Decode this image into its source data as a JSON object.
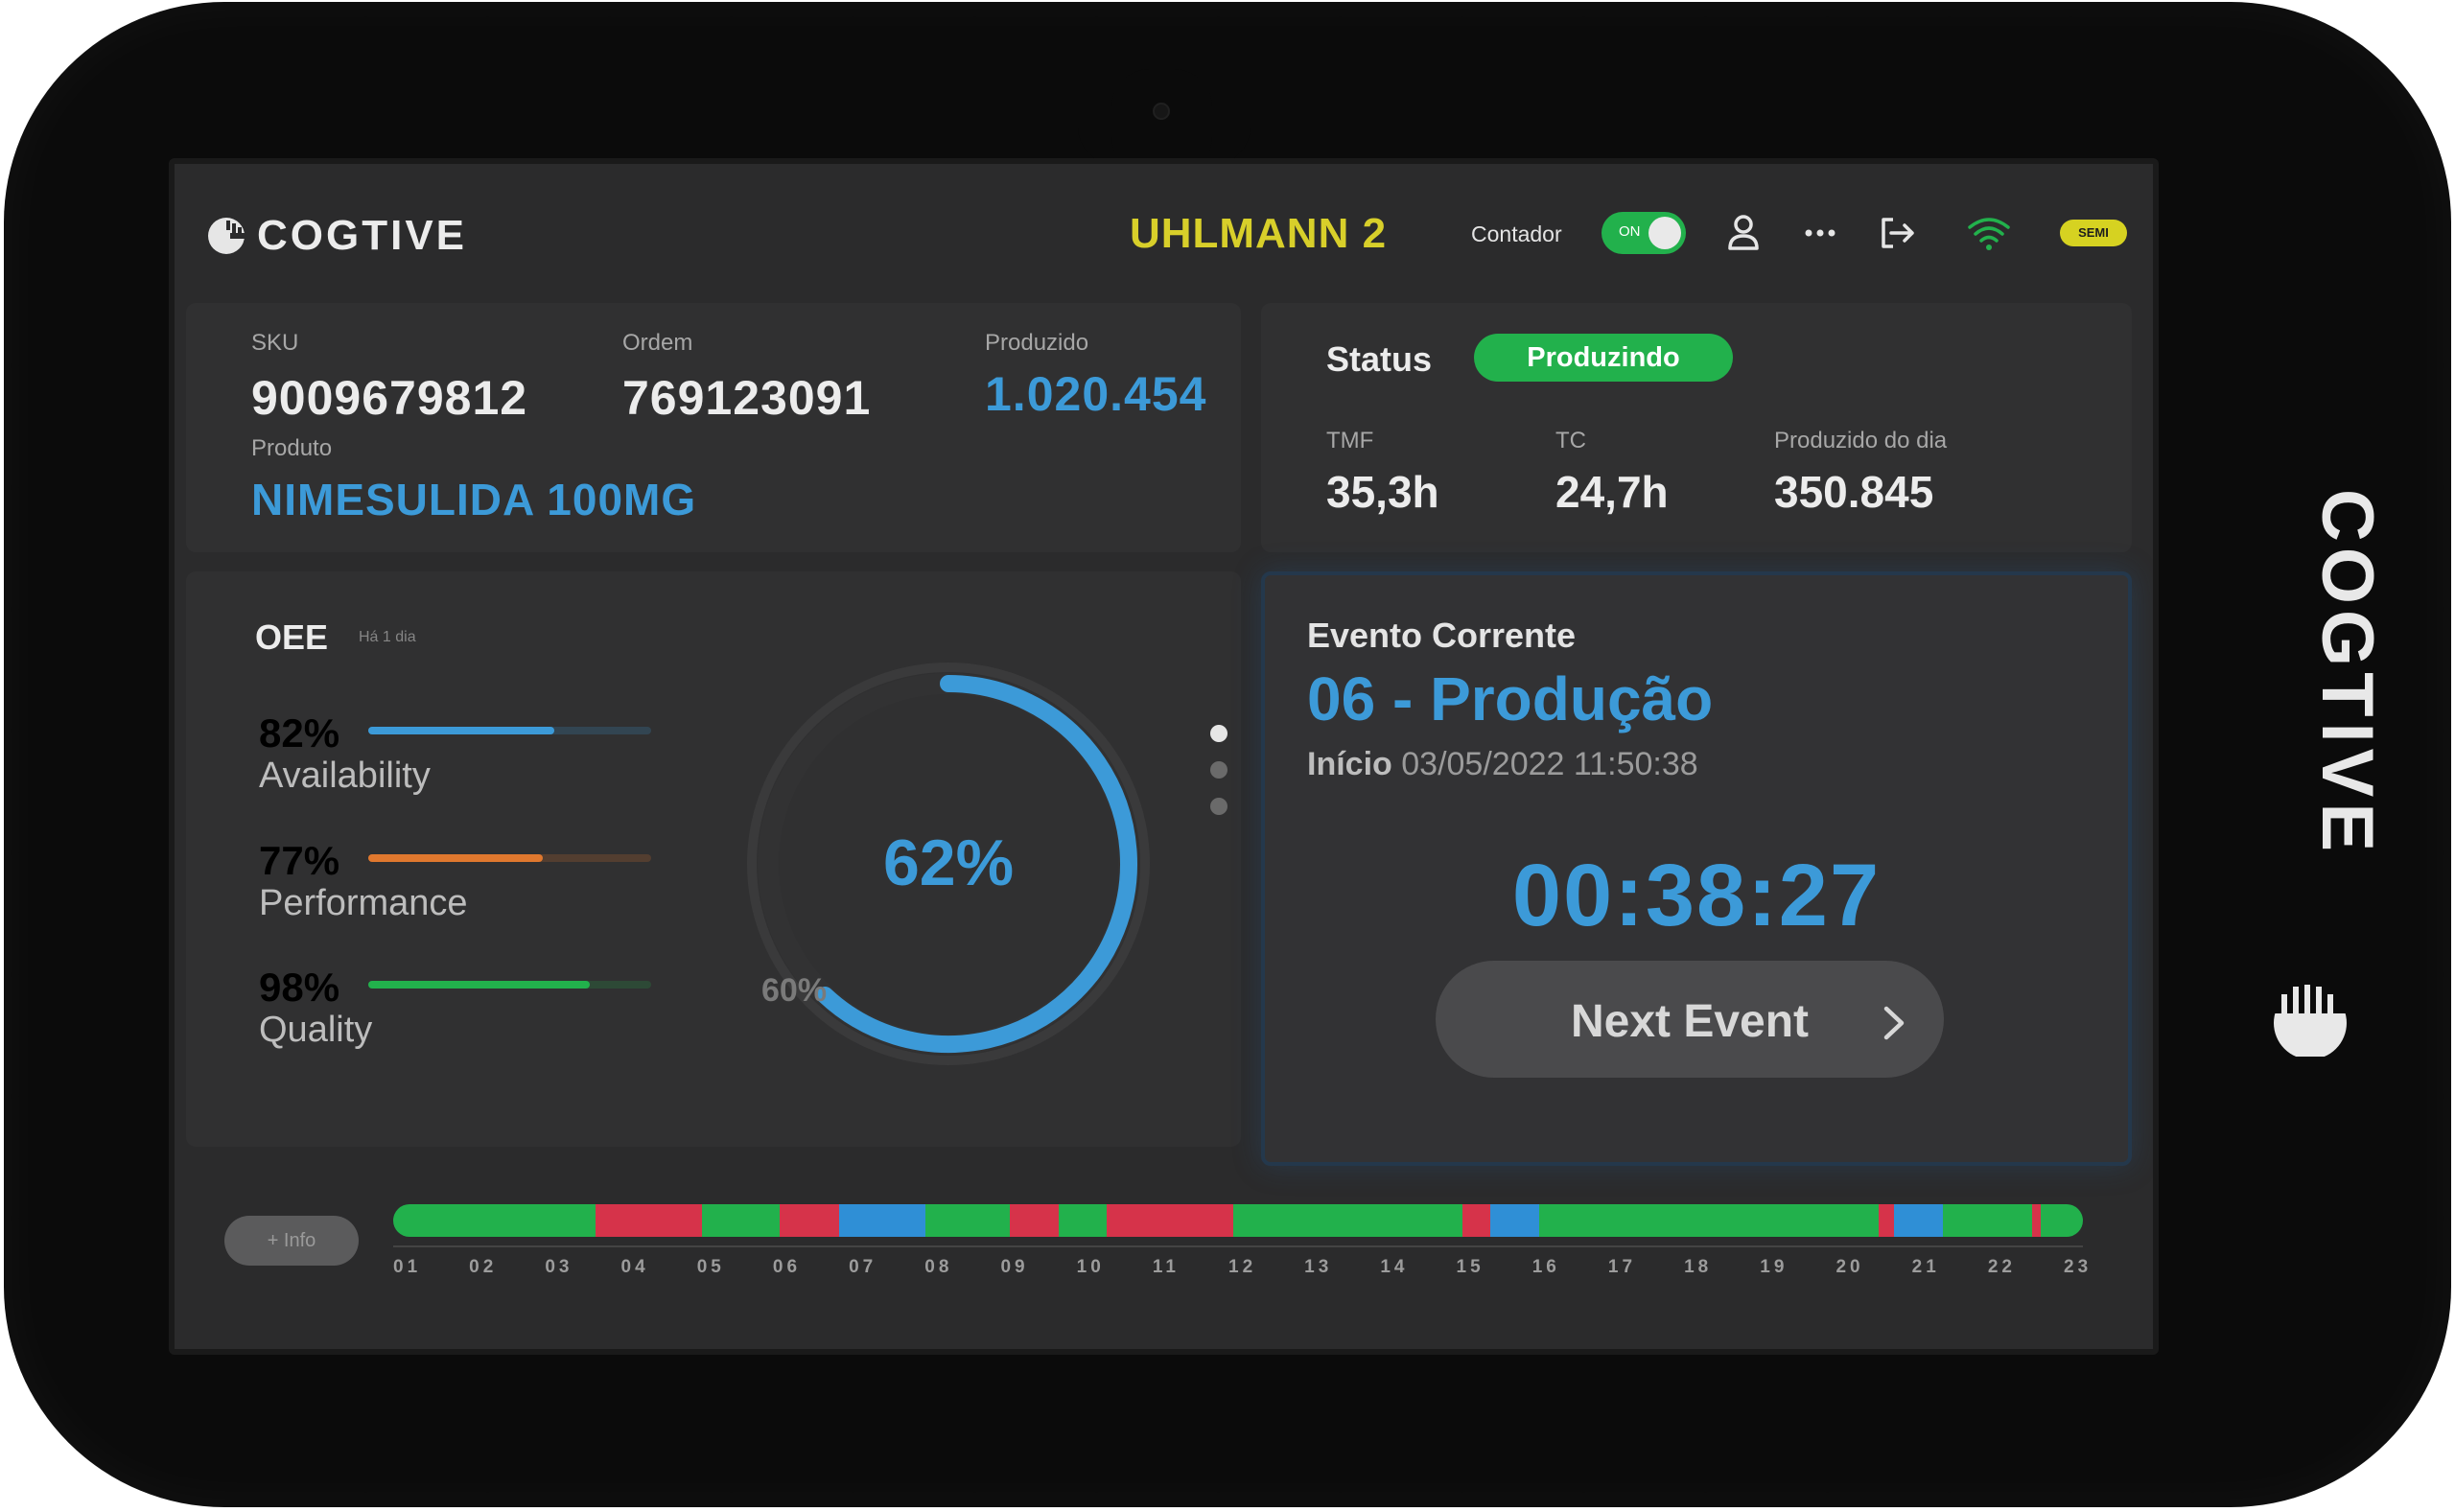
{
  "brand": {
    "name": "COGTIVE"
  },
  "header": {
    "machine": "UHLMANN 2",
    "counter_label": "Contador",
    "counter_toggle": "ON",
    "mode_badge": "SEMI",
    "icons": [
      "user-icon",
      "more-icon",
      "logout-icon",
      "wifi-icon"
    ]
  },
  "order": {
    "sku_label": "SKU",
    "sku": "9009679812",
    "order_label": "Ordem",
    "order": "769123091",
    "produced_label": "Produzido",
    "produced": "1.020.454",
    "product_label": "Produto",
    "product": "NIMESULIDA 100MG"
  },
  "status": {
    "label": "Status",
    "value": "Produzindo",
    "tmf_label": "TMF",
    "tmf": "35,3h",
    "tc_label": "TC",
    "tc": "24,7h",
    "daily_label": "Produzido do dia",
    "daily": "350.845"
  },
  "oee": {
    "title": "OEE",
    "period": "Há 1 dia",
    "value": "62%",
    "value_num": 62,
    "target": "60%",
    "target_num": 60,
    "kpis": [
      {
        "pct": "82%",
        "value": 82,
        "name": "Availability",
        "color": "#3c9ad8"
      },
      {
        "pct": "77%",
        "value": 77,
        "name": "Performance",
        "color": "#e0782e"
      },
      {
        "pct": "98%",
        "value": 98,
        "name": "Quality",
        "color": "#22b14c"
      }
    ]
  },
  "event": {
    "heading": "Evento Corrente",
    "name": "06 - Produção",
    "start_label": "Início",
    "start": "03/05/2022 11:50:38",
    "timer": "00:38:27",
    "next_label": "Next Event"
  },
  "timeline": {
    "info_label": "+ Info",
    "hours": [
      "01",
      "02",
      "03",
      "04",
      "05",
      "06",
      "07",
      "08",
      "09",
      "10",
      "11",
      "12",
      "13",
      "14",
      "15",
      "16",
      "17",
      "18",
      "19",
      "20",
      "21",
      "22",
      "23"
    ],
    "colors": {
      "produzindo": "#22b14c",
      "parada": "#d6334a",
      "setup": "#2f8fd6"
    },
    "segments": [
      {
        "start": 0,
        "end": 0.12,
        "state": "produzindo"
      },
      {
        "start": 0.12,
        "end": 0.183,
        "state": "parada"
      },
      {
        "start": 0.183,
        "end": 0.229,
        "state": "produzindo"
      },
      {
        "start": 0.229,
        "end": 0.264,
        "state": "parada"
      },
      {
        "start": 0.264,
        "end": 0.315,
        "state": "setup"
      },
      {
        "start": 0.315,
        "end": 0.365,
        "state": "produzindo"
      },
      {
        "start": 0.365,
        "end": 0.394,
        "state": "parada"
      },
      {
        "start": 0.394,
        "end": 0.422,
        "state": "produzindo"
      },
      {
        "start": 0.422,
        "end": 0.497,
        "state": "parada"
      },
      {
        "start": 0.497,
        "end": 0.633,
        "state": "produzindo"
      },
      {
        "start": 0.633,
        "end": 0.649,
        "state": "parada"
      },
      {
        "start": 0.649,
        "end": 0.678,
        "state": "setup"
      },
      {
        "start": 0.678,
        "end": 0.879,
        "state": "produzindo"
      },
      {
        "start": 0.879,
        "end": 0.888,
        "state": "parada"
      },
      {
        "start": 0.888,
        "end": 0.917,
        "state": "setup"
      },
      {
        "start": 0.917,
        "end": 0.97,
        "state": "produzindo"
      },
      {
        "start": 0.97,
        "end": 0.975,
        "state": "parada"
      },
      {
        "start": 0.975,
        "end": 1.0,
        "state": "produzindo"
      }
    ]
  }
}
